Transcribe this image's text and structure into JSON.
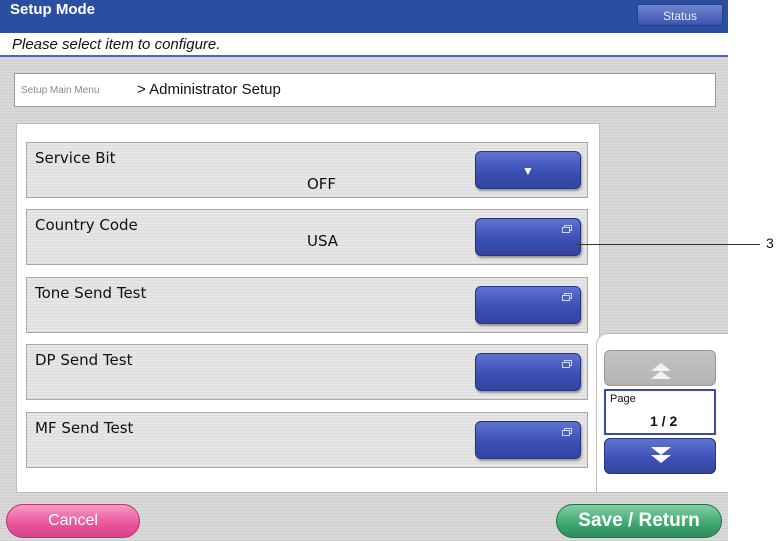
{
  "titlebar": {
    "title": "Setup Mode",
    "status_label": "Status"
  },
  "prompt": "Please select item to configure.",
  "breadcrumb": {
    "parent": "Setup Main Menu",
    "separator_current": "> Administrator Setup"
  },
  "items": [
    {
      "label": "Service Bit",
      "value": "OFF",
      "button_icon": "dropdown-arrow"
    },
    {
      "label": "Country Code",
      "value": "USA",
      "button_icon": "window-icon"
    },
    {
      "label": "Tone Send Test",
      "value": "",
      "button_icon": "window-icon"
    },
    {
      "label": "DP Send Test",
      "value": "",
      "button_icon": "window-icon"
    },
    {
      "label": "MF Send Test",
      "value": "",
      "button_icon": "window-icon"
    }
  ],
  "pager": {
    "page_label": "Page",
    "page_value": "1 / 2"
  },
  "footer": {
    "cancel_label": "Cancel",
    "save_label": "Save / Return"
  },
  "callout": {
    "number": "3"
  },
  "colors": {
    "title_blue": "#2a4fa0",
    "button_blue": "#3c4fb5",
    "cancel_pink": "#e9559c",
    "save_green": "#3fa66f"
  }
}
